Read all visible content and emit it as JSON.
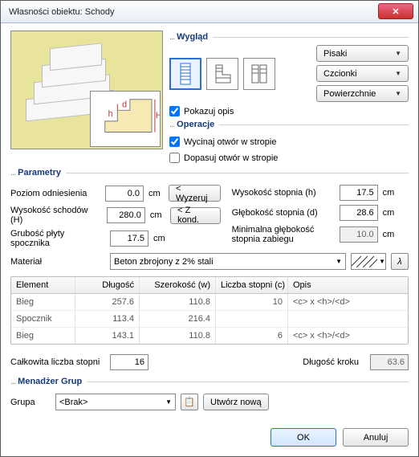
{
  "window": {
    "title": "Własności obiektu: Schody"
  },
  "buttons": {
    "pens": "Pisaki",
    "fonts": "Czcionki",
    "surfaces": "Powierzchnie",
    "recalc": "< Wyzeruj",
    "fromconst": "< Z kond.",
    "newgroup": "Utwórz nową",
    "ok": "OK",
    "cancel": "Anuluj",
    "lambda": "λ"
  },
  "sections": {
    "appearance": "Wygląd",
    "operations": "Operacje",
    "parameters": "Parametry",
    "groupmanager": "Menadżer Grup"
  },
  "checks": {
    "showdesc": "Pokazuj opis",
    "cutslab": "Wycinaj otwór w stropie",
    "fithole": "Dopasuj otwór w stropie"
  },
  "params": {
    "reference_label": "Poziom odniesienia",
    "reference_value": "0.0",
    "stair_h_label": "Wysokość schodów (H)",
    "stair_h_value": "280.0",
    "landing_label": "Grubość płyty spocznika",
    "landing_value": "17.5",
    "material_label": "Materiał",
    "material_value": "Beton zbrojony z 2% stali",
    "step_h_label": "Wysokość stopnia (h)",
    "step_h_value": "17.5",
    "step_d_label": "Głębokość stopnia (d)",
    "step_d_value": "28.6",
    "winder_label": "Minimalna głębokość stopnia zabiegu",
    "winder_value": "10.0",
    "totalsteps_label": "Całkowita liczba stopni",
    "totalsteps_value": "16",
    "stride_label": "Długość kroku",
    "stride_value": "63.6",
    "unit_cm": "cm",
    "group_label": "Grupa",
    "group_value": "<Brak>"
  },
  "table": {
    "headers": {
      "element": "Element",
      "length": "Długość",
      "width": "Szerokość (w)",
      "count": "Liczba stopni (c)",
      "desc": "Opis"
    },
    "rows": [
      {
        "element": "Bieg",
        "length": "257.6",
        "width": "110.8",
        "count": "10",
        "desc": "<c> x <h>/<d>"
      },
      {
        "element": "Spocznik",
        "length": "113.4",
        "width": "216.4",
        "count": "",
        "desc": ""
      },
      {
        "element": "Bieg",
        "length": "143.1",
        "width": "110.8",
        "count": "6",
        "desc": "<c> x <h>/<d>"
      }
    ]
  }
}
